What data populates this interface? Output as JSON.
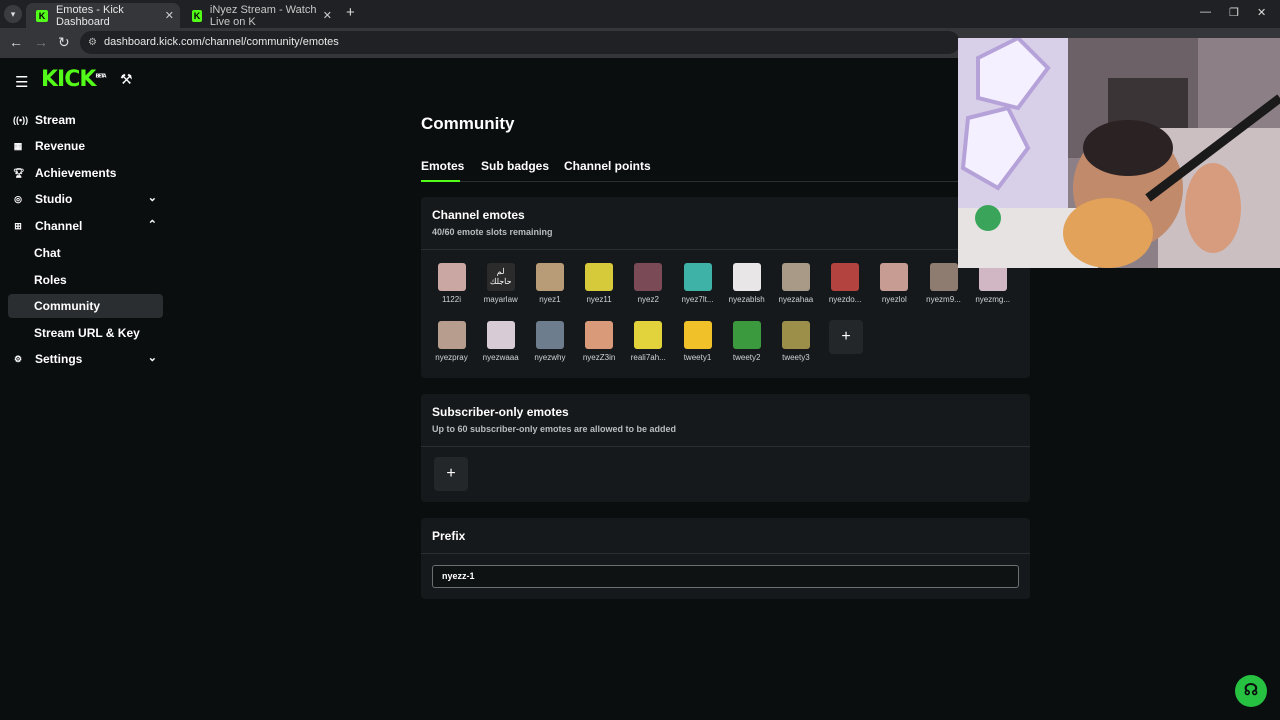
{
  "browser": {
    "tabs": [
      {
        "title": "Emotes - Kick Dashboard",
        "active": true
      },
      {
        "title": "iNyez Stream - Watch Live on K",
        "active": false
      }
    ],
    "url": "dashboard.kick.com/channel/community/emotes"
  },
  "brand": {
    "logo_text": "KICK",
    "beta_label": "BETA",
    "accent": "#53fc18"
  },
  "sidebar": {
    "items": [
      {
        "label": "Stream",
        "icon": "broadcast-icon"
      },
      {
        "label": "Revenue",
        "icon": "revenue-icon"
      },
      {
        "label": "Achievements",
        "icon": "trophy-icon"
      },
      {
        "label": "Studio",
        "icon": "studio-icon",
        "expandable": true
      },
      {
        "label": "Channel",
        "icon": "channel-icon",
        "expanded": true
      },
      {
        "label": "Chat"
      },
      {
        "label": "Roles"
      },
      {
        "label": "Community",
        "active": true
      },
      {
        "label": "Stream URL & Key"
      },
      {
        "label": "Settings",
        "icon": "gear-icon",
        "expandable": true
      }
    ]
  },
  "page": {
    "title": "Community",
    "tabs": [
      "Emotes",
      "Sub badges",
      "Channel points"
    ],
    "active_tab": "Emotes"
  },
  "channel_emotes": {
    "title": "Channel emotes",
    "subtitle": "40/60 emote slots remaining",
    "emotes": [
      {
        "name": "1122i",
        "color": "#caa7a3"
      },
      {
        "name": "mayarlaw",
        "color": "#2b2b2b"
      },
      {
        "name": "nyez1",
        "color": "#b89c78"
      },
      {
        "name": "nyez11",
        "color": "#d6c93a"
      },
      {
        "name": "nyez2",
        "color": "#7a4a57"
      },
      {
        "name": "nyez7lt...",
        "color": "#3fb2a8"
      },
      {
        "name": "nyezablsh",
        "color": "#e9e6e8"
      },
      {
        "name": "nyezahaa",
        "color": "#a89a86"
      },
      {
        "name": "nyezdo...",
        "color": "#b2433f"
      },
      {
        "name": "nyezlol",
        "color": "#c69c93"
      },
      {
        "name": "nyezm9...",
        "color": "#8e7c70"
      },
      {
        "name": "nyezmg...",
        "color": "#d1b7c4"
      },
      {
        "name": "nyezpray",
        "color": "#b79d8d"
      },
      {
        "name": "nyezwaaa",
        "color": "#d7ccd6"
      },
      {
        "name": "nyezwhy",
        "color": "#6e7d8e"
      },
      {
        "name": "nyezZ3in",
        "color": "#d99a7a"
      },
      {
        "name": "reali7ah...",
        "color": "#e2d23b"
      },
      {
        "name": "tweety1",
        "color": "#f1c12a"
      },
      {
        "name": "tweety2",
        "color": "#3c9a3e"
      },
      {
        "name": "tweety3",
        "color": "#9b8f4a"
      }
    ],
    "mayarlaw_text": "لم حاجلك"
  },
  "subscriber_emotes": {
    "title": "Subscriber-only emotes",
    "subtitle": "Up to 60 subscriber-only emotes are allowed to be added"
  },
  "prefix": {
    "title": "Prefix",
    "value": "nyezz-1"
  },
  "icons": {
    "add": "+",
    "chevron_down": "⌄",
    "chevron_up": "⌃"
  }
}
